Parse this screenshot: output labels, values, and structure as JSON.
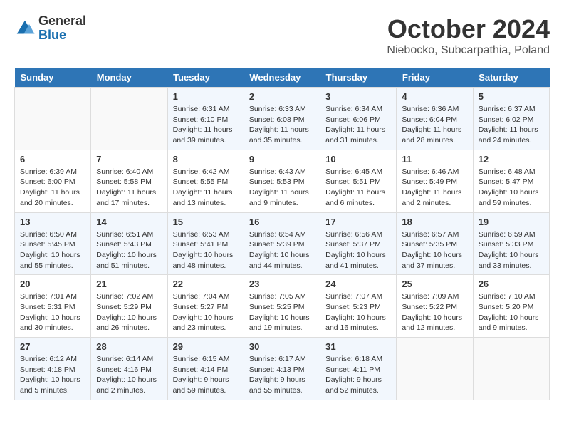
{
  "header": {
    "logo_general": "General",
    "logo_blue": "Blue",
    "month_title": "October 2024",
    "location": "Niebocko, Subcarpathia, Poland"
  },
  "calendar": {
    "days": [
      "Sunday",
      "Monday",
      "Tuesday",
      "Wednesday",
      "Thursday",
      "Friday",
      "Saturday"
    ]
  },
  "weeks": [
    [
      {
        "num": "",
        "sunrise": "",
        "sunset": "",
        "daylight": "",
        "empty": true
      },
      {
        "num": "",
        "sunrise": "",
        "sunset": "",
        "daylight": "",
        "empty": true
      },
      {
        "num": "1",
        "sunrise": "Sunrise: 6:31 AM",
        "sunset": "Sunset: 6:10 PM",
        "daylight": "Daylight: 11 hours and 39 minutes."
      },
      {
        "num": "2",
        "sunrise": "Sunrise: 6:33 AM",
        "sunset": "Sunset: 6:08 PM",
        "daylight": "Daylight: 11 hours and 35 minutes."
      },
      {
        "num": "3",
        "sunrise": "Sunrise: 6:34 AM",
        "sunset": "Sunset: 6:06 PM",
        "daylight": "Daylight: 11 hours and 31 minutes."
      },
      {
        "num": "4",
        "sunrise": "Sunrise: 6:36 AM",
        "sunset": "Sunset: 6:04 PM",
        "daylight": "Daylight: 11 hours and 28 minutes."
      },
      {
        "num": "5",
        "sunrise": "Sunrise: 6:37 AM",
        "sunset": "Sunset: 6:02 PM",
        "daylight": "Daylight: 11 hours and 24 minutes."
      }
    ],
    [
      {
        "num": "6",
        "sunrise": "Sunrise: 6:39 AM",
        "sunset": "Sunset: 6:00 PM",
        "daylight": "Daylight: 11 hours and 20 minutes."
      },
      {
        "num": "7",
        "sunrise": "Sunrise: 6:40 AM",
        "sunset": "Sunset: 5:58 PM",
        "daylight": "Daylight: 11 hours and 17 minutes."
      },
      {
        "num": "8",
        "sunrise": "Sunrise: 6:42 AM",
        "sunset": "Sunset: 5:55 PM",
        "daylight": "Daylight: 11 hours and 13 minutes."
      },
      {
        "num": "9",
        "sunrise": "Sunrise: 6:43 AM",
        "sunset": "Sunset: 5:53 PM",
        "daylight": "Daylight: 11 hours and 9 minutes."
      },
      {
        "num": "10",
        "sunrise": "Sunrise: 6:45 AM",
        "sunset": "Sunset: 5:51 PM",
        "daylight": "Daylight: 11 hours and 6 minutes."
      },
      {
        "num": "11",
        "sunrise": "Sunrise: 6:46 AM",
        "sunset": "Sunset: 5:49 PM",
        "daylight": "Daylight: 11 hours and 2 minutes."
      },
      {
        "num": "12",
        "sunrise": "Sunrise: 6:48 AM",
        "sunset": "Sunset: 5:47 PM",
        "daylight": "Daylight: 10 hours and 59 minutes."
      }
    ],
    [
      {
        "num": "13",
        "sunrise": "Sunrise: 6:50 AM",
        "sunset": "Sunset: 5:45 PM",
        "daylight": "Daylight: 10 hours and 55 minutes."
      },
      {
        "num": "14",
        "sunrise": "Sunrise: 6:51 AM",
        "sunset": "Sunset: 5:43 PM",
        "daylight": "Daylight: 10 hours and 51 minutes."
      },
      {
        "num": "15",
        "sunrise": "Sunrise: 6:53 AM",
        "sunset": "Sunset: 5:41 PM",
        "daylight": "Daylight: 10 hours and 48 minutes."
      },
      {
        "num": "16",
        "sunrise": "Sunrise: 6:54 AM",
        "sunset": "Sunset: 5:39 PM",
        "daylight": "Daylight: 10 hours and 44 minutes."
      },
      {
        "num": "17",
        "sunrise": "Sunrise: 6:56 AM",
        "sunset": "Sunset: 5:37 PM",
        "daylight": "Daylight: 10 hours and 41 minutes."
      },
      {
        "num": "18",
        "sunrise": "Sunrise: 6:57 AM",
        "sunset": "Sunset: 5:35 PM",
        "daylight": "Daylight: 10 hours and 37 minutes."
      },
      {
        "num": "19",
        "sunrise": "Sunrise: 6:59 AM",
        "sunset": "Sunset: 5:33 PM",
        "daylight": "Daylight: 10 hours and 33 minutes."
      }
    ],
    [
      {
        "num": "20",
        "sunrise": "Sunrise: 7:01 AM",
        "sunset": "Sunset: 5:31 PM",
        "daylight": "Daylight: 10 hours and 30 minutes."
      },
      {
        "num": "21",
        "sunrise": "Sunrise: 7:02 AM",
        "sunset": "Sunset: 5:29 PM",
        "daylight": "Daylight: 10 hours and 26 minutes."
      },
      {
        "num": "22",
        "sunrise": "Sunrise: 7:04 AM",
        "sunset": "Sunset: 5:27 PM",
        "daylight": "Daylight: 10 hours and 23 minutes."
      },
      {
        "num": "23",
        "sunrise": "Sunrise: 7:05 AM",
        "sunset": "Sunset: 5:25 PM",
        "daylight": "Daylight: 10 hours and 19 minutes."
      },
      {
        "num": "24",
        "sunrise": "Sunrise: 7:07 AM",
        "sunset": "Sunset: 5:23 PM",
        "daylight": "Daylight: 10 hours and 16 minutes."
      },
      {
        "num": "25",
        "sunrise": "Sunrise: 7:09 AM",
        "sunset": "Sunset: 5:22 PM",
        "daylight": "Daylight: 10 hours and 12 minutes."
      },
      {
        "num": "26",
        "sunrise": "Sunrise: 7:10 AM",
        "sunset": "Sunset: 5:20 PM",
        "daylight": "Daylight: 10 hours and 9 minutes."
      }
    ],
    [
      {
        "num": "27",
        "sunrise": "Sunrise: 6:12 AM",
        "sunset": "Sunset: 4:18 PM",
        "daylight": "Daylight: 10 hours and 5 minutes."
      },
      {
        "num": "28",
        "sunrise": "Sunrise: 6:14 AM",
        "sunset": "Sunset: 4:16 PM",
        "daylight": "Daylight: 10 hours and 2 minutes."
      },
      {
        "num": "29",
        "sunrise": "Sunrise: 6:15 AM",
        "sunset": "Sunset: 4:14 PM",
        "daylight": "Daylight: 9 hours and 59 minutes."
      },
      {
        "num": "30",
        "sunrise": "Sunrise: 6:17 AM",
        "sunset": "Sunset: 4:13 PM",
        "daylight": "Daylight: 9 hours and 55 minutes."
      },
      {
        "num": "31",
        "sunrise": "Sunrise: 6:18 AM",
        "sunset": "Sunset: 4:11 PM",
        "daylight": "Daylight: 9 hours and 52 minutes."
      },
      {
        "num": "",
        "sunrise": "",
        "sunset": "",
        "daylight": "",
        "empty": true
      },
      {
        "num": "",
        "sunrise": "",
        "sunset": "",
        "daylight": "",
        "empty": true
      }
    ]
  ]
}
